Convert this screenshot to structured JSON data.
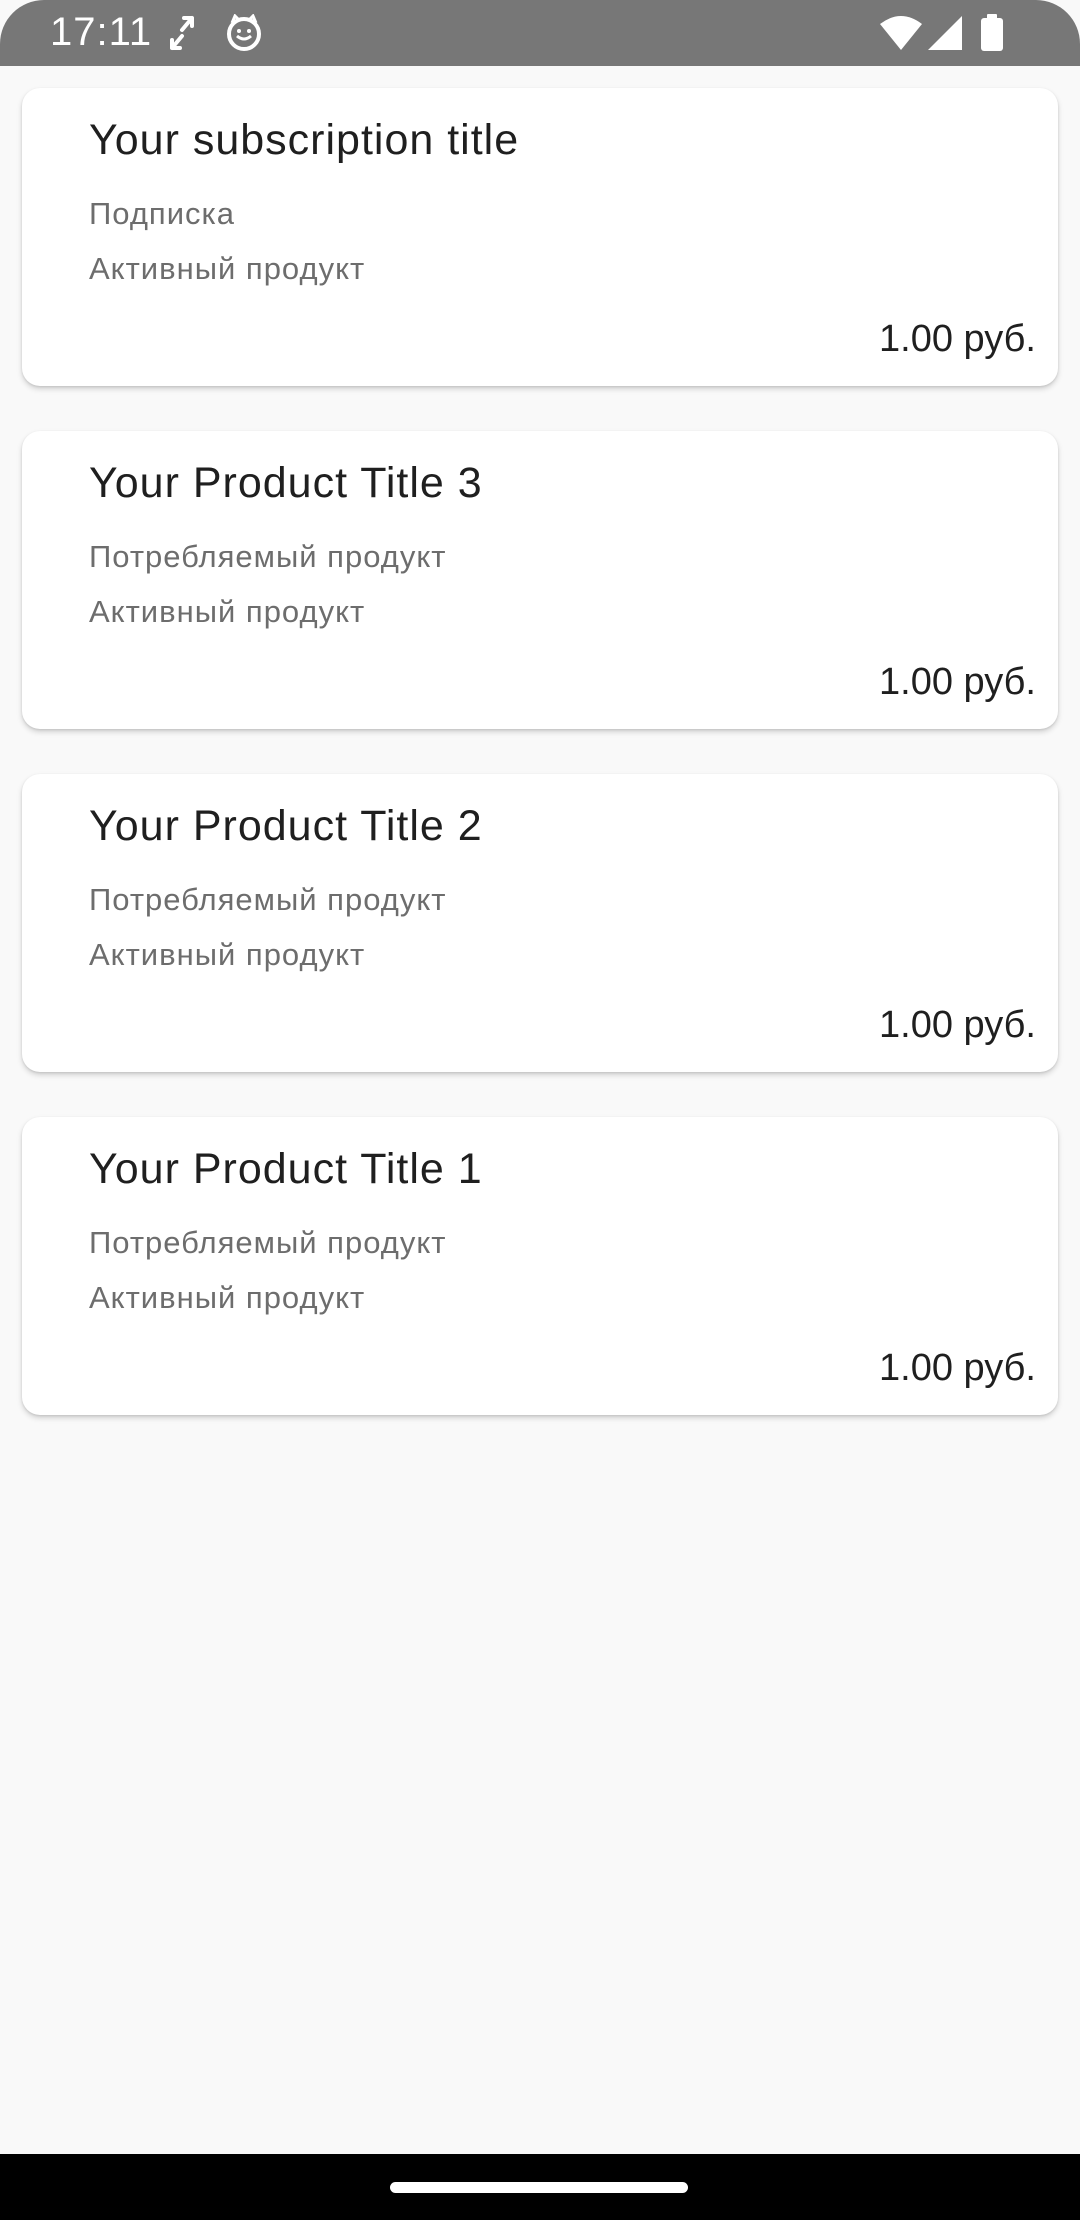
{
  "status_bar": {
    "time": "17:11",
    "background_color": "#777777",
    "icons": [
      "sync-arrows-icon",
      "cat-face-icon",
      "wifi-icon",
      "signal-icon",
      "battery-icon"
    ]
  },
  "products": [
    {
      "title": "Your subscription title",
      "type": "Подписка",
      "state": "Активный продукт",
      "price": "1.00 руб."
    },
    {
      "title": "Your Product Title 3",
      "type": "Потребляемый продукт",
      "state": "Активный продукт",
      "price": "1.00 руб."
    },
    {
      "title": "Your Product Title 2",
      "type": "Потребляемый продукт",
      "state": "Активный продукт",
      "price": "1.00 руб."
    },
    {
      "title": "Your Product Title 1",
      "type": "Потребляемый продукт",
      "state": "Активный продукт",
      "price": "1.00 руб."
    }
  ],
  "colors": {
    "page_background": "#f9f9f9",
    "card_background": "#ffffff",
    "title_text": "#1f1f1f",
    "secondary_text": "#6d6d6d",
    "navigation_bar": "#000000"
  }
}
